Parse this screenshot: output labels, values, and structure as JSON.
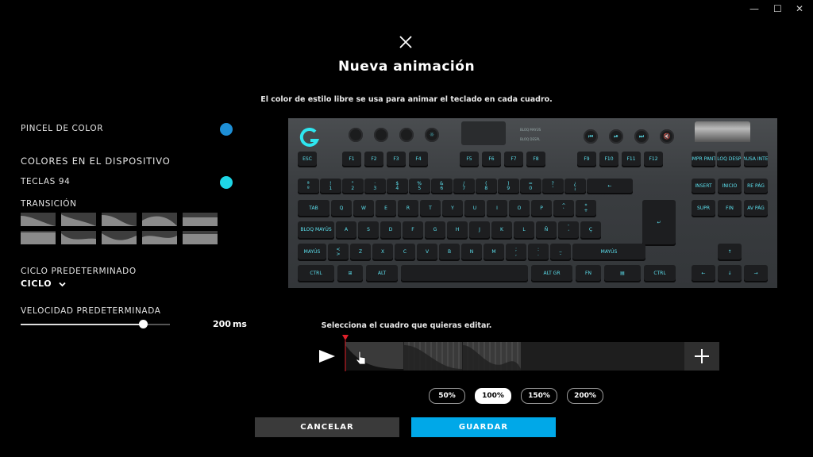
{
  "window": {
    "min_icon": "—",
    "max_icon": "☐",
    "close_icon": "✕"
  },
  "dialog": {
    "title": "Nueva animación",
    "subtitle": "El color de estilo libre se usa para animar el teclado en cada cuadro."
  },
  "left": {
    "brush_label": "PINCEL DE COLOR",
    "brush_color": "#1e8fd6",
    "device_colors_label": "COLORES EN EL DISPOSITIVO",
    "keys_label": "TECLAS 94",
    "keys_color": "#1ed6e6",
    "transition_label": "TRANSICIÓN",
    "cycle_label": "CICLO PREDETERMINADO",
    "cycle_value": "CICLO",
    "speed_label": "VELOCIDAD PREDETERMINADA",
    "speed_value": "200",
    "speed_unit": "ms",
    "speed_fraction": 0.82
  },
  "keyboard": {
    "key_color": "#5ce0ee",
    "media_labels": [
      "⏮",
      "⏯",
      "⏭",
      "🔇"
    ],
    "indicator_labels": [
      "BLOQ MAYÚS",
      "BLOQ DESPL"
    ],
    "function_row": [
      "ESC",
      "F1",
      "F2",
      "F3",
      "F4",
      "F5",
      "F6",
      "F7",
      "F8",
      "F9",
      "F10",
      "F11",
      "F12",
      "IMPR PANT",
      "BLOQ DESPL",
      "PAUSA INTER"
    ],
    "number_row": [
      "ª\nº",
      "!\n1",
      "\"\n2",
      "·\n3",
      "$\n4",
      "%\n5",
      "&\n6",
      "/\n7",
      "(\n8",
      ")\n9",
      "=\n0",
      "?\n'",
      "¿\n¡",
      "←",
      "INSERT",
      "INICIO",
      "RE PÁG"
    ],
    "q_row": [
      "TAB",
      "Q",
      "W",
      "E",
      "R",
      "T",
      "Y",
      "U",
      "I",
      "O",
      "P",
      "^\n`",
      "*\n+",
      "SUPR",
      "FIN",
      "AV PÁG"
    ],
    "a_row": [
      "BLOQ MAYÚS",
      "A",
      "S",
      "D",
      "F",
      "G",
      "H",
      "J",
      "K",
      "L",
      "Ñ",
      "¨\n´",
      "Ç"
    ],
    "enter_label": "↵",
    "z_row": [
      "MAYÚS",
      "<\n>",
      "Z",
      "X",
      "C",
      "V",
      "B",
      "N",
      "M",
      ";\n,",
      ":\n.",
      "_\n-",
      "MAYÚS",
      "↑"
    ],
    "bottom_row": [
      "CTRL",
      "⊞",
      "ALT",
      "",
      "ALT GR",
      "FN",
      "▤",
      "CTRL",
      "←",
      "↓",
      "→"
    ]
  },
  "timeline": {
    "hint": "Selecciona el cuadro que quieras editar.",
    "play_icon": "▶",
    "add_icon": "+",
    "frame_count": 3,
    "playhead_color": "#e0202a"
  },
  "zoom": {
    "options": [
      "50%",
      "100%",
      "150%",
      "200%"
    ],
    "selected": "100%"
  },
  "actions": {
    "cancel": "CANCELAR",
    "save": "GUARDAR",
    "save_color": "#00a8e8",
    "cancel_color": "#3a3a3a"
  }
}
